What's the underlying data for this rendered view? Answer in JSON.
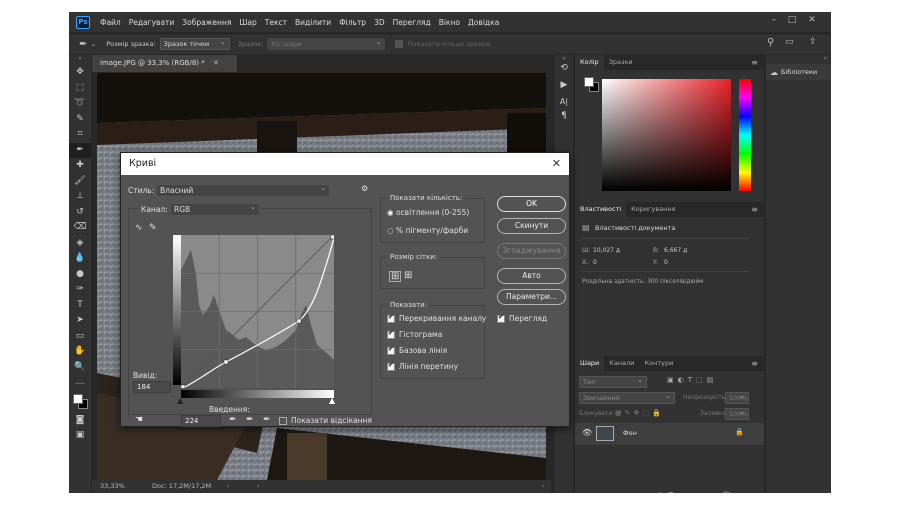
{
  "menubar": {
    "app_logo": "Ps",
    "items": [
      "Файл",
      "Редагувати",
      "Зображення",
      "Шар",
      "Текст",
      "Виділити",
      "Фільтр",
      "3D",
      "Перегляд",
      "Вікно",
      "Довідка"
    ]
  },
  "options_bar": {
    "sample_size_label": "Розмір зразка:",
    "sample_size_value": "Зразок точки",
    "sample_label": "Зразок:",
    "sample_value": "Усі шари",
    "show_ring_label": "Показати кільце зразків"
  },
  "document": {
    "tab_title": "image.JPG @ 33,3% (RGB/8) *",
    "zoom": "33,33%",
    "doc_size": "Doc: 17,2M/17,2M"
  },
  "color_panel": {
    "tabs": [
      "Колір",
      "Зразки"
    ],
    "foreground": "#ffffff",
    "background": "#000000",
    "hue_color": "#e8222a"
  },
  "properties_panel": {
    "tabs": [
      "Властивості",
      "Коригування"
    ],
    "title": "Властивості документа",
    "w_label": "Ш:",
    "w_value": "10,027 д",
    "h_label": "В:",
    "h_value": "6,667 д",
    "x_label": "X:",
    "x_value": "0",
    "y_label": "Y:",
    "y_value": "0",
    "resolution": "Роздільна здатність: 300 пікселів/дюйм"
  },
  "layers_panel": {
    "tabs": [
      "Шари",
      "Канали",
      "Контури"
    ],
    "filter_label": "Тип",
    "blend_mode": "Звичайний",
    "opacity_label": "Непрозорість:",
    "opacity_value": "100%",
    "lock_label": "Блокувати:",
    "fill_label": "Заливка:",
    "fill_value": "100%",
    "layer_name": "Фон"
  },
  "libraries": {
    "label": "Бібліотеки"
  },
  "curves_dialog": {
    "title": "Криві",
    "preset_label": "Стиль:",
    "preset_value": "Власний",
    "channel_label": "Канал:",
    "channel_value": "RGB",
    "output_label": "Вивід:",
    "output_value": "184",
    "input_label": "Введення:",
    "input_value": "224",
    "show_clipping_label": "Показати відсікання",
    "show_amount_title": "Показати кількість:",
    "light_option": "освітлення  (0-255)",
    "pigment_option": "% пігменту/фарби",
    "grid_size_title": "Розмір сітки:",
    "show_title": "Показати:",
    "show_overlay": "Перекривання каналу",
    "show_histogram": "Гістограма",
    "show_baseline": "Базова лінія",
    "show_intersection": "Лінія перетину",
    "ok_button": "OK",
    "cancel_button": "Скинути",
    "smooth_button": "Згладжування",
    "auto_button": "Авто",
    "options_button": "Параметри...",
    "preview_label": "Перегляд"
  }
}
